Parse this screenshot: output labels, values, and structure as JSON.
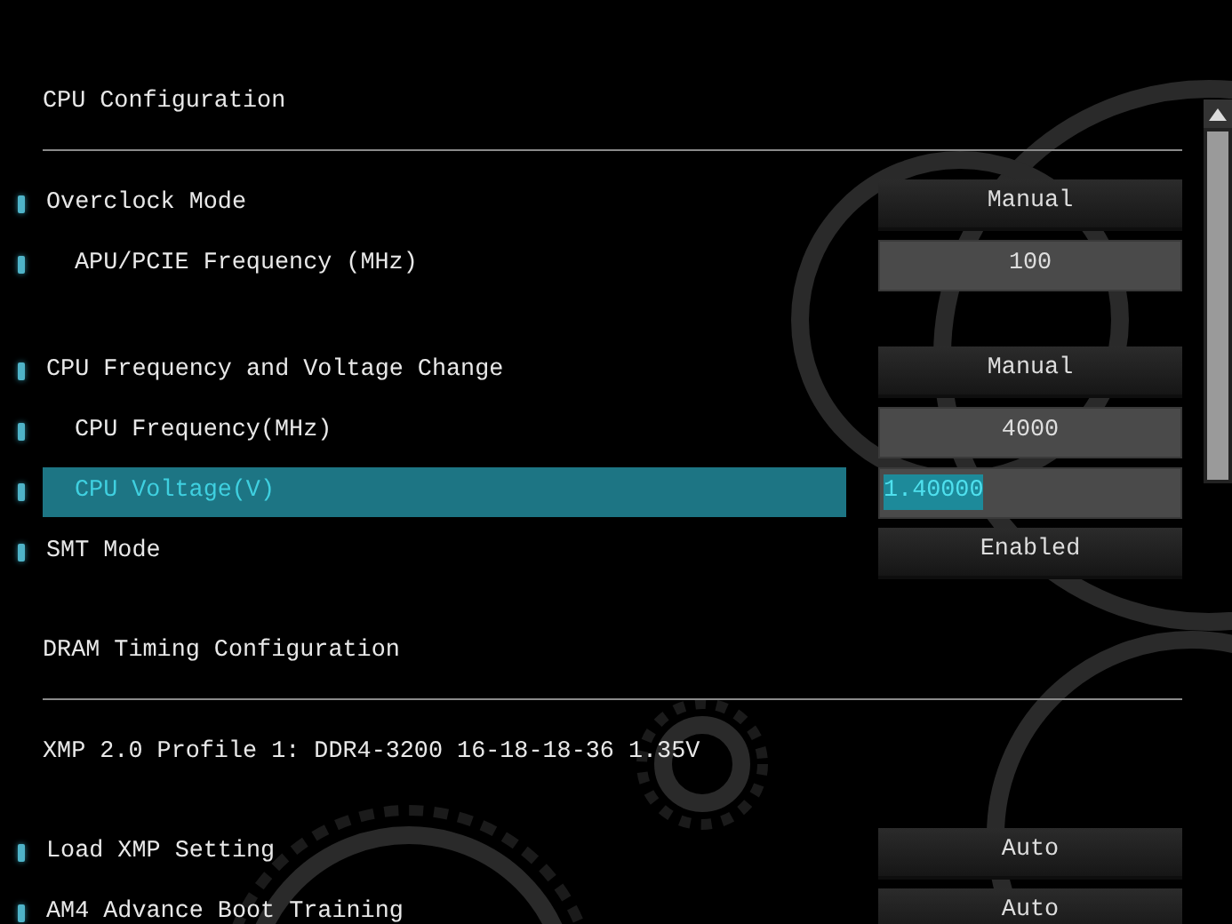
{
  "sections": [
    {
      "title": "CPU Configuration",
      "groups": [
        [
          {
            "label": "Overclock Mode",
            "value": "Manual",
            "kind": "dropdown",
            "selected": false,
            "children": [
              {
                "label": "APU/PCIE Frequency (MHz)",
                "value": "100",
                "kind": "number",
                "selected": false
              }
            ]
          }
        ],
        [
          {
            "label": "CPU Frequency and Voltage Change",
            "value": "Manual",
            "kind": "dropdown",
            "selected": false,
            "children": [
              {
                "label": "CPU Frequency(MHz)",
                "value": "4000",
                "kind": "number",
                "selected": false
              },
              {
                "label": "CPU Voltage(V)",
                "value": "1.40000",
                "kind": "number",
                "selected": true
              }
            ]
          },
          {
            "label": "SMT Mode",
            "value": "Enabled",
            "kind": "dropdown",
            "selected": false
          }
        ]
      ]
    },
    {
      "title": "DRAM Timing Configuration",
      "info": "XMP 2.0 Profile 1: DDR4-3200 16-18-18-36 1.35V",
      "groups": [
        [
          {
            "label": "Load XMP Setting",
            "value": "Auto",
            "kind": "dropdown",
            "selected": false
          },
          {
            "label": "AM4 Advance Boot Training",
            "value": "Auto",
            "kind": "dropdown",
            "selected": false
          }
        ]
      ]
    }
  ]
}
